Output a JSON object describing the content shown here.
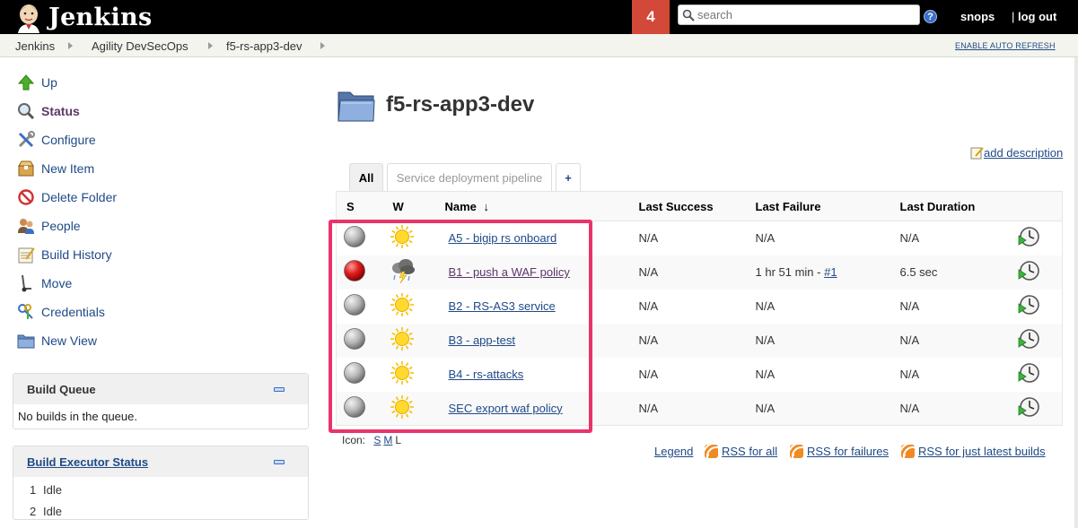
{
  "header": {
    "app_title": "Jenkins",
    "notification_count": "4",
    "search_placeholder": "search",
    "help_label": "?",
    "user_name": "snops",
    "separator": "|",
    "logout_label": "log out"
  },
  "breadcrumbs": {
    "items": [
      "Jenkins",
      "Agility DevSecOps",
      "f5-rs-app3-dev"
    ],
    "auto_refresh_label": "ENABLE AUTO REFRESH"
  },
  "sidebar": {
    "tasks": [
      {
        "label": "Up",
        "icon": "up-arrow-icon"
      },
      {
        "label": "Status",
        "icon": "magnifier-icon"
      },
      {
        "label": "Configure",
        "icon": "tools-icon"
      },
      {
        "label": "New Item",
        "icon": "package-icon"
      },
      {
        "label": "Delete Folder",
        "icon": "no-entry-icon"
      },
      {
        "label": "People",
        "icon": "people-icon"
      },
      {
        "label": "Build History",
        "icon": "notepad-icon"
      },
      {
        "label": "Move",
        "icon": "hand-truck-icon"
      },
      {
        "label": "Credentials",
        "icon": "keys-icon"
      },
      {
        "label": "New View",
        "icon": "folder-icon"
      }
    ]
  },
  "build_queue": {
    "title": "Build Queue",
    "empty_text": "No builds in the queue."
  },
  "executor_status": {
    "title": "Build Executor Status",
    "executors": [
      {
        "num": "1",
        "state": "Idle"
      },
      {
        "num": "2",
        "state": "Idle"
      }
    ]
  },
  "main": {
    "title": "f5-rs-app3-dev",
    "add_description_label": "add description",
    "tabs": {
      "all": "All",
      "pipeline": "Service deployment pipeline",
      "add": "+"
    },
    "table": {
      "headers": {
        "status": "S",
        "weather": "W",
        "name": "Name",
        "sort_arrow": "↓",
        "last_success": "Last Success",
        "last_failure": "Last Failure",
        "last_duration": "Last Duration"
      },
      "rows": [
        {
          "name": "A5 - bigip rs onboard",
          "status": "grey",
          "weather": "sunny",
          "last_success": "N/A",
          "last_failure": "N/A",
          "failure_build": "",
          "last_duration": "N/A"
        },
        {
          "name": "B1 - push a WAF policy",
          "status": "red",
          "weather": "thunderstorm",
          "last_success": "N/A",
          "last_failure": "1 hr 51 min - ",
          "failure_build": "#1",
          "last_duration": "6.5 sec"
        },
        {
          "name": "B2 - RS-AS3 service",
          "status": "grey",
          "weather": "sunny",
          "last_success": "N/A",
          "last_failure": "N/A",
          "failure_build": "",
          "last_duration": "N/A"
        },
        {
          "name": "B3 - app-test",
          "status": "grey",
          "weather": "sunny",
          "last_success": "N/A",
          "last_failure": "N/A",
          "failure_build": "",
          "last_duration": "N/A"
        },
        {
          "name": "B4  - rs-attacks",
          "status": "grey",
          "weather": "sunny",
          "last_success": "N/A",
          "last_failure": "N/A",
          "failure_build": "",
          "last_duration": "N/A"
        },
        {
          "name": "SEC export waf policy",
          "status": "grey",
          "weather": "sunny",
          "last_success": "N/A",
          "last_failure": "N/A",
          "failure_build": "",
          "last_duration": "N/A"
        }
      ]
    },
    "icon_size": {
      "label": "Icon:",
      "sizes": [
        "S",
        "M",
        "L"
      ]
    },
    "footer_links": {
      "legend": "Legend",
      "rss_all": "RSS for all",
      "rss_failures": "RSS for failures",
      "rss_latest": "RSS for just latest builds"
    }
  },
  "colors": {
    "header_bg": "#000000",
    "notification_bg": "#d24939",
    "link": "#204a87",
    "visited_link": "#5c3566",
    "highlight": "#e8336b"
  }
}
